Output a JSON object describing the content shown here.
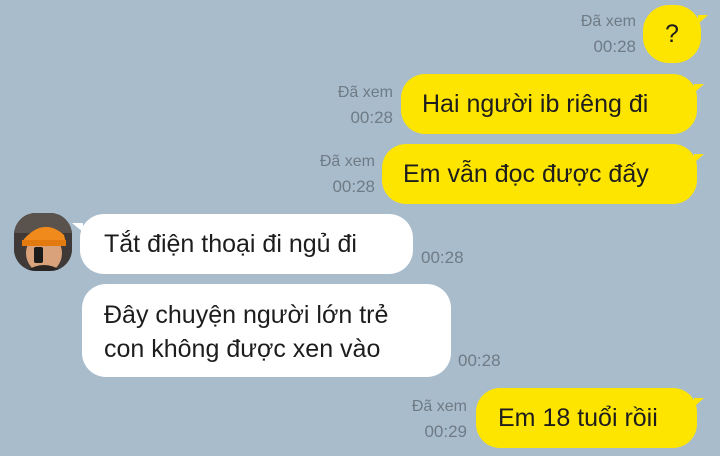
{
  "messages": [
    {
      "sender": "me",
      "text": "?",
      "read_receipt": "Đã xem",
      "time": "00:28"
    },
    {
      "sender": "me",
      "text": "Hai người ib riêng đi",
      "read_receipt": "Đã xem",
      "time": "00:28"
    },
    {
      "sender": "me",
      "text": "Em vẫn đọc được đấy",
      "read_receipt": "Đã xem",
      "time": "00:28"
    },
    {
      "sender": "them",
      "text": "Tắt điện thoại đi ngủ đi",
      "time": "00:28"
    },
    {
      "sender": "them",
      "lines": [
        "Đây chuyện người lớn trẻ",
        "con không được xen vào"
      ],
      "time": "00:28"
    },
    {
      "sender": "me",
      "text": "Em 18 tuổi rồii",
      "read_receipt": "Đã xem",
      "time": "00:29"
    }
  ],
  "colors": {
    "background": "#a9bccc",
    "my_bubble": "#fee500",
    "their_bubble": "#ffffff",
    "meta_text": "#6f7b85"
  },
  "contact": {
    "avatar_icon": "contact-avatar-photo"
  }
}
